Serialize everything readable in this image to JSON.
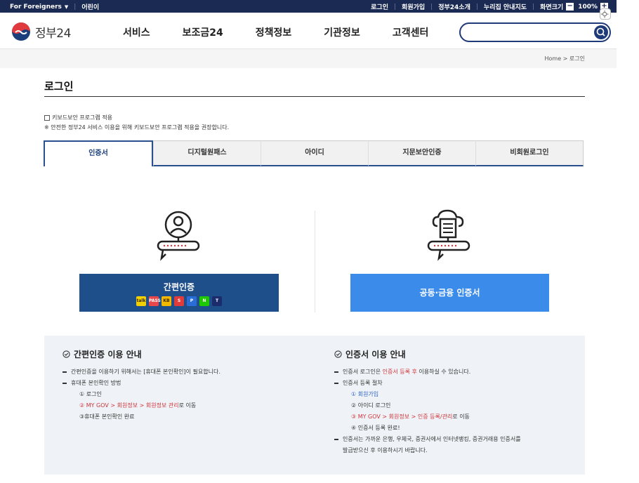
{
  "topbar": {
    "foreigners": "For Foreigners",
    "kids": "어린이",
    "login": "로그인",
    "signup": "회원가입",
    "about": "정부24소개",
    "sitemap": "누리집 안내지도",
    "screen_size": "화면크기",
    "zoom_minus": "−",
    "zoom_value": "100%",
    "zoom_plus": "+"
  },
  "header": {
    "logo_text": "정부24",
    "menu": [
      "서비스",
      "보조금24",
      "정책정보",
      "기관정보",
      "고객센터"
    ],
    "search_placeholder": ""
  },
  "breadcrumb": "Home  >  로그인",
  "page": {
    "title": "로그인",
    "keyboard_security": "키보드보안 프로그램 적용",
    "keyboard_note": "※ 안전한 정부24 서비스 이용을 위해 키보드보안 프로그램 적용을 권장합니다."
  },
  "tabs": [
    "인증서",
    "디지털원패스",
    "아이디",
    "지문보안인증",
    "비회원로그인"
  ],
  "auth": {
    "simple_label": "간편인증",
    "providers": [
      {
        "name": "kakao",
        "label": "talk",
        "color": "#f2d000"
      },
      {
        "name": "pass",
        "label": "PASS",
        "color": "#e8484c"
      },
      {
        "name": "kb",
        "label": "KB",
        "color": "#f2b800"
      },
      {
        "name": "samsung",
        "label": "S",
        "color": "#1b4fa0"
      },
      {
        "name": "payco",
        "label": "P",
        "color": "#e13a3a"
      },
      {
        "name": "naver",
        "label": "N",
        "color": "#1ec800"
      },
      {
        "name": "toss",
        "label": "T",
        "color": "#1a2c6b"
      }
    ],
    "cert_label": "공동·금융 인증서"
  },
  "guide": {
    "left": {
      "title": "간편인증 이용 안내",
      "line1": "간편인증을 이용하기 위해서는 [휴대폰 본인확인]이 필요합니다.",
      "line2": "휴대폰 본인확인 방법",
      "step1": "① 로그인",
      "step2_a": "② MY GOV > 회원정보 > 회원정보 관리",
      "step2_b": "로 이동",
      "step3": "③휴대폰 본인확인 완료"
    },
    "right": {
      "title": "인증서 이용 안내",
      "line1_a": "인증서 로그인은 ",
      "line1_b": "인증서 등록 후",
      "line1_c": " 이용하실 수 있습니다.",
      "line2": "인증서 등록 절차",
      "step1": "① 회원가입",
      "step2": "② 아이디 로그인",
      "step3_a": "③ MY GOV > 회원정보 > 인증 등록/관리",
      "step3_b": "로 이동",
      "step4": "④ 인증서 등록 완료!",
      "line3_a": "인증서는 가까운 은행, 우체국, 증권사에서 인터넷뱅킹, 증권거래용 인증서를",
      "line3_b": "발급받으신 후 이용하시기 바랍니다."
    }
  }
}
